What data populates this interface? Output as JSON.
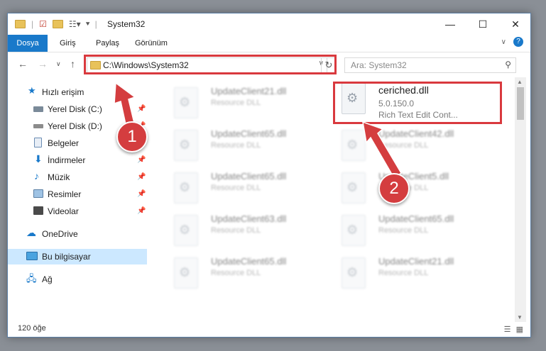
{
  "window": {
    "title": "System32"
  },
  "ribbon": {
    "tabs": [
      "Dosya",
      "Giriş",
      "Paylaş",
      "Görünüm"
    ]
  },
  "address": {
    "path": "C:\\Windows\\System32"
  },
  "search": {
    "placeholder": "Ara: System32"
  },
  "sidebar": {
    "items": [
      {
        "label": "Hızlı erişim"
      },
      {
        "label": "Yerel Disk (C:)"
      },
      {
        "label": "Yerel Disk (D:)"
      },
      {
        "label": "Belgeler"
      },
      {
        "label": "İndirmeler"
      },
      {
        "label": "Müzik"
      },
      {
        "label": "Resimler"
      },
      {
        "label": "Videolar"
      },
      {
        "label": "OneDrive"
      },
      {
        "label": "Bu bilgisayar"
      },
      {
        "label": "Ağ"
      }
    ]
  },
  "files": {
    "highlighted": {
      "name": "ceriched.dll",
      "version": "5.0.150.0",
      "description": "Rich Text Edit Cont..."
    },
    "left_column": [
      {
        "name": "UpdateClient21.dll",
        "type": "Resource DLL"
      },
      {
        "name": "UpdateClient65.dll",
        "type": "Resource DLL"
      },
      {
        "name": "UpdateClient65.dll",
        "type": "Resource DLL"
      },
      {
        "name": "UpdateClient63.dll",
        "type": "Resource DLL"
      },
      {
        "name": "UpdateClient65.dll",
        "type": "Resource DLL"
      }
    ],
    "right_column": [
      {
        "name": "UpdateClient42.dll",
        "type": "Resource DLL"
      },
      {
        "name": "UpdateClient5.dll",
        "type": "Resource DLL"
      },
      {
        "name": "UpdateClient65.dll",
        "type": "Resource DLL"
      },
      {
        "name": "UpdateClient21.dll",
        "type": "Resource DLL"
      }
    ]
  },
  "status": {
    "count": "120 öğe"
  },
  "annotations": {
    "badge1": "1",
    "badge2": "2"
  },
  "colors": {
    "accent": "#1979ca",
    "highlight_box": "#d9393e",
    "selection": "#cce8ff"
  }
}
